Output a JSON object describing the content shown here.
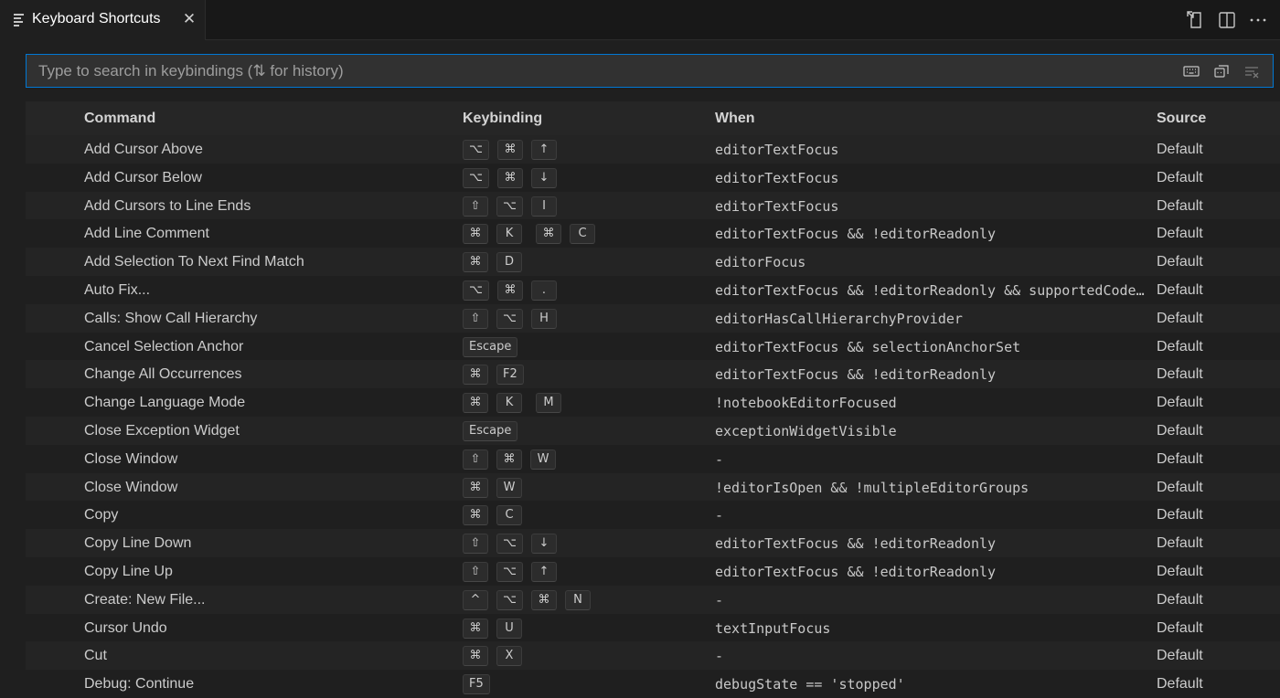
{
  "tab": {
    "title": "Keyboard Shortcuts",
    "close_glyph": "✕"
  },
  "search": {
    "placeholder": "Type to search in keybindings (⇅ for history)",
    "value": ""
  },
  "headers": {
    "command": "Command",
    "keybinding": "Keybinding",
    "when": "When",
    "source": "Source"
  },
  "rows": [
    {
      "command": "Add Cursor Above",
      "keys": [
        [
          "⌥",
          "⌘",
          "↑"
        ]
      ],
      "when": "editorTextFocus",
      "source": "Default"
    },
    {
      "command": "Add Cursor Below",
      "keys": [
        [
          "⌥",
          "⌘",
          "↓"
        ]
      ],
      "when": "editorTextFocus",
      "source": "Default"
    },
    {
      "command": "Add Cursors to Line Ends",
      "keys": [
        [
          "⇧",
          "⌥",
          "I"
        ]
      ],
      "when": "editorTextFocus",
      "source": "Default"
    },
    {
      "command": "Add Line Comment",
      "keys": [
        [
          "⌘",
          "K"
        ],
        [
          "⌘",
          "C"
        ]
      ],
      "when": "editorTextFocus && !editorReadonly",
      "source": "Default"
    },
    {
      "command": "Add Selection To Next Find Match",
      "keys": [
        [
          "⌘",
          "D"
        ]
      ],
      "when": "editorFocus",
      "source": "Default"
    },
    {
      "command": "Auto Fix...",
      "keys": [
        [
          "⌥",
          "⌘",
          "."
        ]
      ],
      "when": "editorTextFocus && !editorReadonly && supportedCode…",
      "source": "Default"
    },
    {
      "command": "Calls: Show Call Hierarchy",
      "keys": [
        [
          "⇧",
          "⌥",
          "H"
        ]
      ],
      "when": "editorHasCallHierarchyProvider",
      "source": "Default"
    },
    {
      "command": "Cancel Selection Anchor",
      "keys": [
        [
          "Escape"
        ]
      ],
      "when": "editorTextFocus && selectionAnchorSet",
      "source": "Default"
    },
    {
      "command": "Change All Occurrences",
      "keys": [
        [
          "⌘",
          "F2"
        ]
      ],
      "when": "editorTextFocus && !editorReadonly",
      "source": "Default"
    },
    {
      "command": "Change Language Mode",
      "keys": [
        [
          "⌘",
          "K"
        ],
        [
          "M"
        ]
      ],
      "when": "!notebookEditorFocused",
      "source": "Default"
    },
    {
      "command": "Close Exception Widget",
      "keys": [
        [
          "Escape"
        ]
      ],
      "when": "exceptionWidgetVisible",
      "source": "Default"
    },
    {
      "command": "Close Window",
      "keys": [
        [
          "⇧",
          "⌘",
          "W"
        ]
      ],
      "when": "-",
      "source": "Default"
    },
    {
      "command": "Close Window",
      "keys": [
        [
          "⌘",
          "W"
        ]
      ],
      "when": "!editorIsOpen && !multipleEditorGroups",
      "source": "Default"
    },
    {
      "command": "Copy",
      "keys": [
        [
          "⌘",
          "C"
        ]
      ],
      "when": "-",
      "source": "Default"
    },
    {
      "command": "Copy Line Down",
      "keys": [
        [
          "⇧",
          "⌥",
          "↓"
        ]
      ],
      "when": "editorTextFocus && !editorReadonly",
      "source": "Default"
    },
    {
      "command": "Copy Line Up",
      "keys": [
        [
          "⇧",
          "⌥",
          "↑"
        ]
      ],
      "when": "editorTextFocus && !editorReadonly",
      "source": "Default"
    },
    {
      "command": "Create: New File...",
      "keys": [
        [
          "^",
          "⌥",
          "⌘",
          "N"
        ]
      ],
      "when": "-",
      "source": "Default"
    },
    {
      "command": "Cursor Undo",
      "keys": [
        [
          "⌘",
          "U"
        ]
      ],
      "when": "textInputFocus",
      "source": "Default"
    },
    {
      "command": "Cut",
      "keys": [
        [
          "⌘",
          "X"
        ]
      ],
      "when": "-",
      "source": "Default"
    },
    {
      "command": "Debug: Continue",
      "keys": [
        [
          "F5"
        ]
      ],
      "when": "debugState == 'stopped'",
      "source": "Default"
    }
  ],
  "icons": {
    "tab": "keybindings-editor-icon",
    "actions": [
      "open-keybindings-json-icon",
      "split-editor-icon",
      "more-actions-icon"
    ],
    "search": [
      "record-keys-icon",
      "sort-by-precedence-icon",
      "clear-search-icon"
    ]
  },
  "colors": {
    "accent": "#0078d4",
    "background": "#1f1f1f",
    "row_alt": "#242424"
  }
}
